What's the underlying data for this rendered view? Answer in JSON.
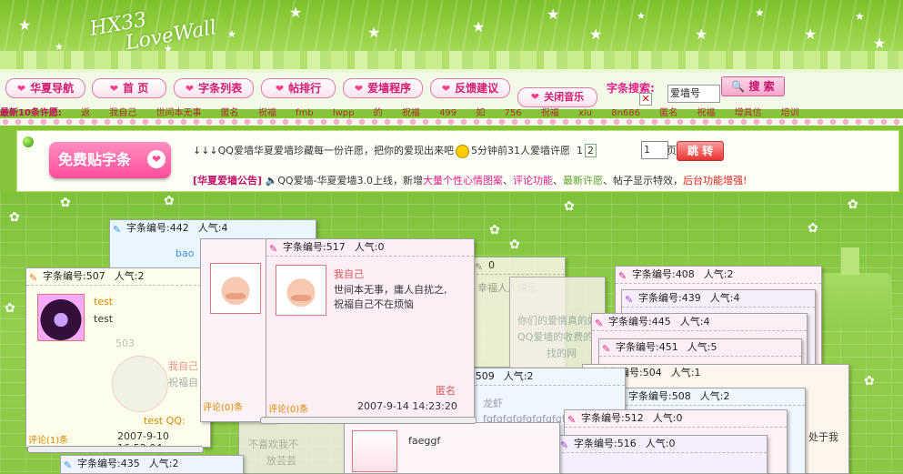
{
  "header": {
    "logo_line1": "HX33",
    "logo_line2": "LoveWall"
  },
  "nav": {
    "items": [
      "华夏导航",
      "首 页",
      "字条列表",
      "帖排行",
      "爱墙程序",
      "反馈建议"
    ],
    "music": "关闭音乐"
  },
  "search": {
    "label": "字条搜索:",
    "value": "爱墙号",
    "button": "搜 索"
  },
  "ticker": {
    "label": "最新10条许愿:",
    "items": [
      "返",
      "我自己",
      "世间本无事",
      "匿名",
      "祝福",
      "fmb",
      "lwpp",
      "的",
      "祝福",
      "499",
      "如",
      "756",
      "祝福",
      "xiu",
      "8n686",
      "匿名",
      "祝福",
      "增具信",
      "培训"
    ]
  },
  "announce": {
    "free_button": "免费贴字条",
    "scroll_text": "↓↓↓QQ爱墙华夏爱墙珍藏每一份许愿，把你的爱现出来吧",
    "scroll_text2": "5分钟前31人爱墙许愿",
    "pages": [
      "1",
      "2"
    ],
    "page_input": "1",
    "page_unit": "页",
    "go_button": "跳 转",
    "notice_tag": "[华夏爱墙公告]",
    "notice_text": "QQ爱墙-华夏爱墙3.0上线，新增",
    "notice_pink1": "大量个性心情图案",
    "notice_sep1": "、",
    "notice_pink2": "评论功能",
    "notice_sep2": "、",
    "notice_green": "最新许愿",
    "notice_sep3": "、帖子显示特效，",
    "notice_red": "后台功能增强!"
  },
  "cards": [
    {
      "id": "442",
      "pop": "4",
      "name": "bao"
    },
    {
      "id": "507",
      "pop": "2",
      "name": "test",
      "content": "test",
      "comments": "评论(1)条",
      "date": "2007-9-10 16:52:04",
      "footer": "test QQ:"
    },
    {
      "id": "503",
      "name": "我自己",
      "content": "祝福自",
      "comments": "评论(0)条"
    },
    {
      "id": "517",
      "pop": "0",
      "name": "我自己",
      "content1": "世间本无事，庸人自扰之,",
      "content2": "祝福自己不在烦恼",
      "author": "匿名",
      "comments": "评论(0)条",
      "date": "2007-9-14 14:23:20"
    },
    {
      "id": "?",
      "pop": "0",
      "content": "幸福人人快乐",
      "name": "匿名"
    },
    {
      "content": "你们的爱情真的好",
      "content2": "QQ爱墙的收费的",
      "content3": "找的网"
    },
    {
      "id": "408",
      "pop": "2"
    },
    {
      "id": "439",
      "pop": "4"
    },
    {
      "id": "445",
      "pop": "4"
    },
    {
      "id": "451",
      "pop": "5"
    },
    {
      "id": "504",
      "pop": "1"
    },
    {
      "id": "508",
      "pop": "2"
    },
    {
      "id": "509",
      "pop": "2",
      "name": "龙虾",
      "content": "fgfgfgfgfgfgfgfgfgfg"
    },
    {
      "id": "512",
      "pop": "0"
    },
    {
      "id": "516",
      "pop": "0",
      "content": "faeggf"
    },
    {
      "id": "435",
      "pop": "2"
    }
  ],
  "labels": {
    "id_prefix": "字条编号:",
    "pop_prefix": "人气:"
  },
  "misc": {
    "right_text": "处于我",
    "bottom_text": "不喜欢我不",
    "bottom_text2": "放芸芸"
  }
}
